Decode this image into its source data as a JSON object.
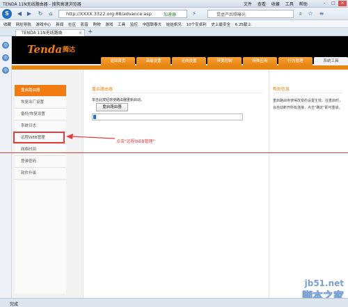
{
  "browser": {
    "window_title": "TENDA 11N无线路由器 - 搜狗高速浏览器",
    "menu": [
      "文件",
      "查看",
      "收藏",
      "工具",
      "帮助"
    ],
    "url": "http://XXXX.3322.org:88/advance.asp",
    "accelerate_label": "加速器",
    "search_placeholder": "昆虚产后照曝光",
    "bookmarks": [
      "收藏",
      "网址导航",
      "游戏中心",
      "新闻",
      "社区",
      "影音",
      "购物",
      "游戏",
      "工具",
      "监控",
      "中国联泰大",
      "娃娃帆兄",
      "10个安卓利",
      "史上最安全",
      "6.25献上"
    ],
    "tab_title": "TENDA 11N无线路由",
    "status_text": "完成"
  },
  "router": {
    "brand": "Tenda",
    "brand_cn": "腾达",
    "nav_tabs": [
      "返回首页",
      "高级设置",
      "无线设置",
      "带宽控制",
      "特殊应用",
      "行为管理",
      "系统工具"
    ],
    "active_tab": "系统工具",
    "side_menu": [
      "重启路由器",
      "恢复出厂设置",
      "备份/恢复设置",
      "系统日志",
      "远程WEB管理",
      "网络时间",
      "登录密码",
      "软件升级"
    ],
    "active_side_item": "重启路由器",
    "section_title": "重启路由器",
    "section_desc": "单击此按钮将使路由器重新启动。",
    "reboot_button": "重启路由器",
    "progress_fraction": 0.02,
    "help_title": "帮助信息",
    "help_text": "重启路由将使得改变的设置生效。在重启时，会自动断开所有连接，点击\"确定\"即可重启。"
  },
  "annotation": {
    "text": "点击\"远程WEB管理\"",
    "color": "#e53b3b"
  },
  "watermark": {
    "line1": "jb51.net",
    "line2": "脚本之家"
  },
  "colors": {
    "accent": "#f07c13",
    "active_tab": "#e58514",
    "annotation_red": "#e53b3b",
    "progress_blue": "#1f73d1"
  }
}
